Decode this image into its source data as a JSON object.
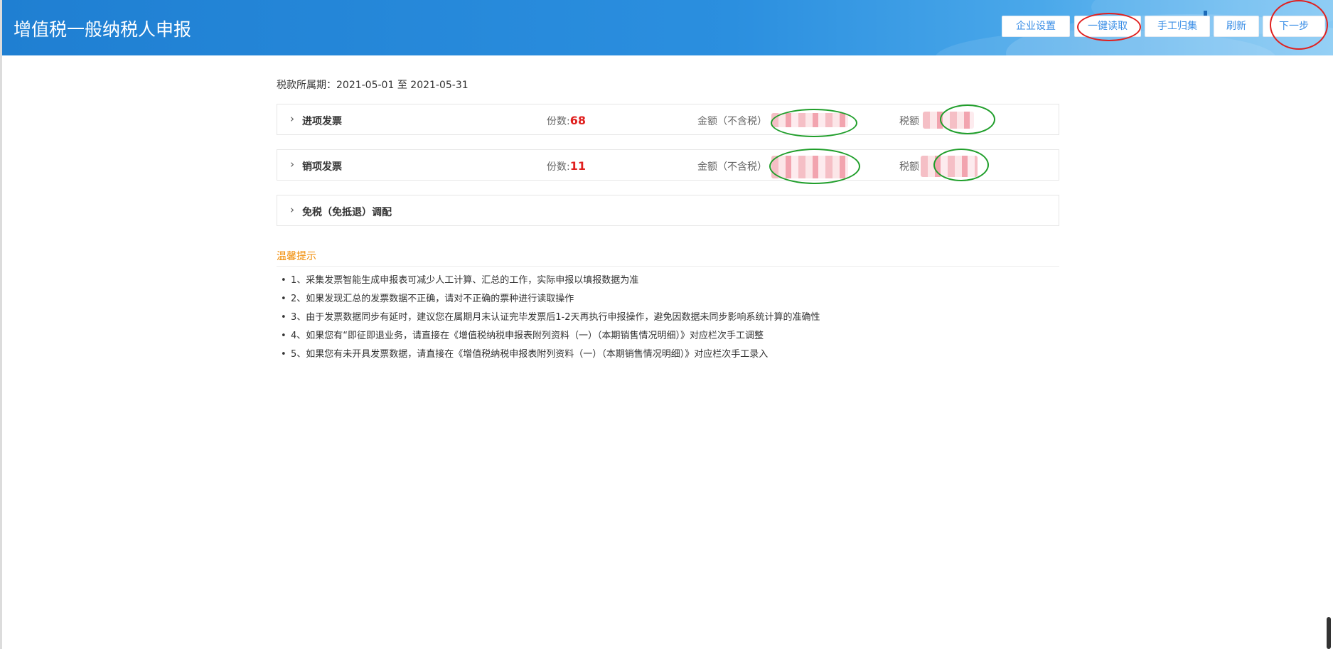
{
  "header": {
    "title": "增值税一般纳税人申报",
    "buttons": {
      "settings": "企业设置",
      "read": "一键读取",
      "manual": "手工归集",
      "refresh": "刷新",
      "next": "下一步"
    }
  },
  "period": {
    "label": "税款所属期：",
    "start": "2021-05-01",
    "sep": "至",
    "end": "2021-05-31"
  },
  "panels": {
    "input_invoice": {
      "name": "进项发票",
      "count_label": "份数:",
      "count": "68",
      "amount_label": "金额（不含税）",
      "tax_label": "税额"
    },
    "output_invoice": {
      "name": "销项发票",
      "count_label": "份数:",
      "count": "11",
      "amount_label": "金额（不含税）",
      "tax_label": "税额"
    },
    "exempt": {
      "name": "免税（免抵退）调配"
    }
  },
  "tips": {
    "title": "温馨提示",
    "items": [
      "1、采集发票智能生成申报表可减少人工计算、汇总的工作，实际申报以填报数据为准",
      "2、如果发现汇总的发票数据不正确，请对不正确的票种进行读取操作",
      "3、由于发票数据同步有延时，建议您在属期月末认证完毕发票后1-2天再执行申报操作，避免因数据未同步影响系统计算的准确性",
      "4、如果您有“即征即退业务，请直接在《增值税纳税申报表附列资料（一）（本期销售情况明细）》对应栏次手工调整",
      "5、如果您有未开具发票数据，请直接在《增值税纳税申报表附列资料（一）（本期销售情况明细）》对应栏次手工录入"
    ]
  },
  "colors": {
    "header_blue": "#2b8fdf",
    "button_text": "#3a8ee6",
    "count_red": "#e0201f",
    "tips_orange": "#f08a00",
    "annotation_red": "#e0201f",
    "annotation_green": "#1f9e2a"
  }
}
